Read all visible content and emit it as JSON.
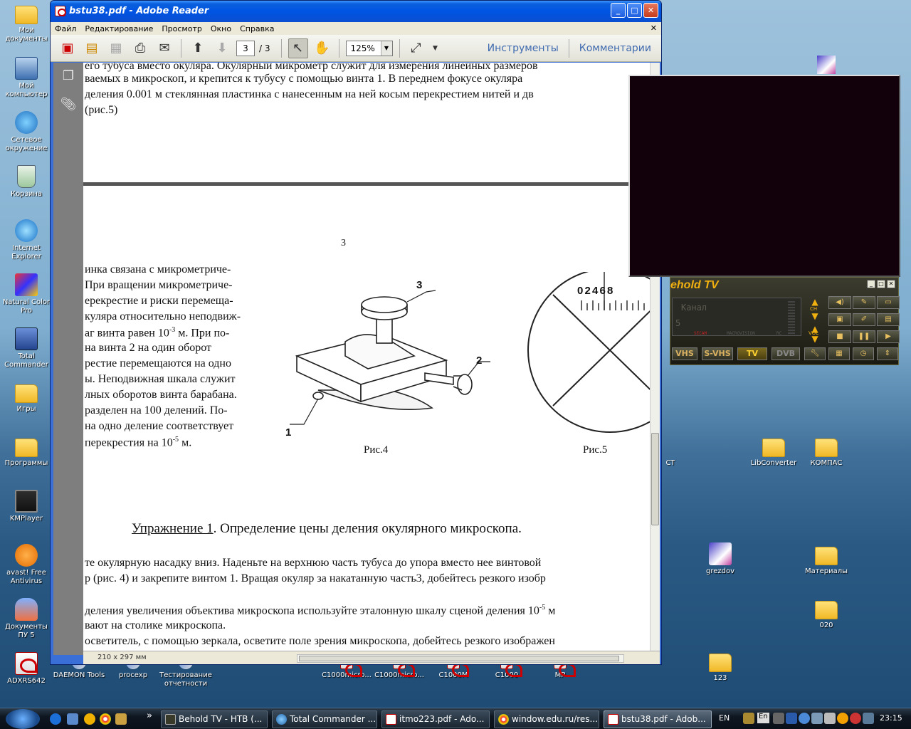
{
  "desktop": {
    "icons_left": [
      {
        "label": "Мои документы",
        "kind": "folder"
      },
      {
        "label": "Мой компьютер",
        "kind": "pc"
      },
      {
        "label": "Сетевое окружение",
        "kind": "net"
      },
      {
        "label": "Корзина",
        "kind": "trash"
      },
      {
        "label": "Internet Explorer",
        "kind": "ie"
      },
      {
        "label": "Natural Color Pro",
        "kind": "nc"
      },
      {
        "label": "Total Commander",
        "kind": "disk"
      },
      {
        "label": "Игры",
        "kind": "folder"
      },
      {
        "label": "Программы",
        "kind": "folder"
      },
      {
        "label": "KMPlayer",
        "kind": "kmp"
      },
      {
        "label": "avast! Free Antivirus",
        "kind": "avast"
      },
      {
        "label": "Документы ПУ 5",
        "kind": "people"
      },
      {
        "label": "ADXRS642",
        "kind": "pdf"
      }
    ],
    "icons_bottom": [
      {
        "label": "DAEMON Tools"
      },
      {
        "label": "procexp"
      },
      {
        "label": "Тестирование отчетности"
      },
      {
        "label": "C1000micro..."
      },
      {
        "label": "C1000micro..."
      },
      {
        "label": "C1000M"
      },
      {
        "label": "C1000"
      },
      {
        "label": "MP"
      },
      {
        "label": "123"
      }
    ],
    "icons_right": [
      {
        "label": "LibConverter"
      },
      {
        "label": "КОМПАС"
      },
      {
        "label": "grezdov"
      },
      {
        "label": "Материалы"
      },
      {
        "label": "020"
      },
      {
        "label": "CT"
      }
    ]
  },
  "adobe": {
    "title": "bstu38.pdf - Adobe Reader",
    "menu": [
      "Файл",
      "Редактирование",
      "Просмотр",
      "Окно",
      "Справка"
    ],
    "page_current": "3",
    "page_total": "/ 3",
    "zoom": "125%",
    "tools_label": "Инструменты",
    "comments_label": "Комментарии",
    "page_size": "210 x 297 мм",
    "doc": {
      "top_lines": [
        "его тубуса вместо окуляра. Окулярный микрометр служит для измерения линейных размеров",
        "ваемых в микроскоп, и крепится к тубусу с помощью  винта 1. В переднем фокусе окуляра",
        "деления 0.001 м стеклянная пластинка с нанесенным на ней косым перекрестием нитей и дв",
        "(рис.5)"
      ],
      "page_number": "3",
      "left_col": [
        "инка  связана  с  микрометриче-",
        "При  вращении  микрометриче-",
        "ерекрестие  и  риски  перемеща-",
        "куляра относительно неподвиж-",
        "аг винта равен   10",
        "на винта 2    на один    оборот",
        "рестие   перемещаются на одно",
        "ы.  Неподвижная  шкала  служит",
        "лных оборотов винта барабана.",
        "разделен на 100 делений.  По-",
        "на одно деление соответствует",
        "перекрестия на 10"
      ],
      "left_col_sup": [
        "-3",
        "-5"
      ],
      "left_col_suffix": [
        " м. При по-",
        " м."
      ],
      "fig4_label": "Рис.4",
      "fig5_label": "Рис.5",
      "fig4_callouts": [
        "3",
        "2",
        "1"
      ],
      "fig5_scale": "0 2 4 6 8",
      "exercise_title": "Упражнение 1",
      "exercise_rest": ". Определение цены деления окулярного микроскопа.",
      "bottom_lines": [
        "те окулярную насадку вниз. Наденьте на верхнюю часть тубуса до упора вместо нее винтовой",
        "р (рис. 4) и закрепите винтом 1. Вращая окуляр за накатанную часть3, добейтесь резкого изобр",
        "деления увеличения объектива микроскопа используйте эталонную шкалу сценой деления 10",
        "вают на столике микроскопа.",
        "осветитель, с помощью зеркала, осветите поле зрения микроскопа, добейтесь резкого изображен"
      ],
      "bottom_sup": "-5",
      "bottom_suffix": " м"
    }
  },
  "tv": {
    "title": "ehold TV",
    "lcd_channel": "Канал",
    "lcd_num": "5",
    "lcd_labels": [
      "SECAM",
      "MACROVISION",
      "RC"
    ],
    "sources": [
      "VHS",
      "S-VHS",
      "TV",
      "DVB"
    ],
    "active_source": "TV",
    "ch_label": "CH",
    "vol_label": "VOL"
  },
  "taskbar": {
    "tasks": [
      {
        "label": "Behold TV - НТВ (..."
      },
      {
        "label": "Total Commander ..."
      },
      {
        "label": "itmo223.pdf - Ado..."
      },
      {
        "label": "window.edu.ru/res..."
      },
      {
        "label": "bstu38.pdf - Adob..."
      }
    ],
    "active_task": 4,
    "lang": "EN",
    "lang2": "En",
    "clock": "23:15",
    "overflow": "»"
  },
  "colors": {
    "xp_blue": "#0054e3",
    "tv_gold": "#f0b010"
  }
}
